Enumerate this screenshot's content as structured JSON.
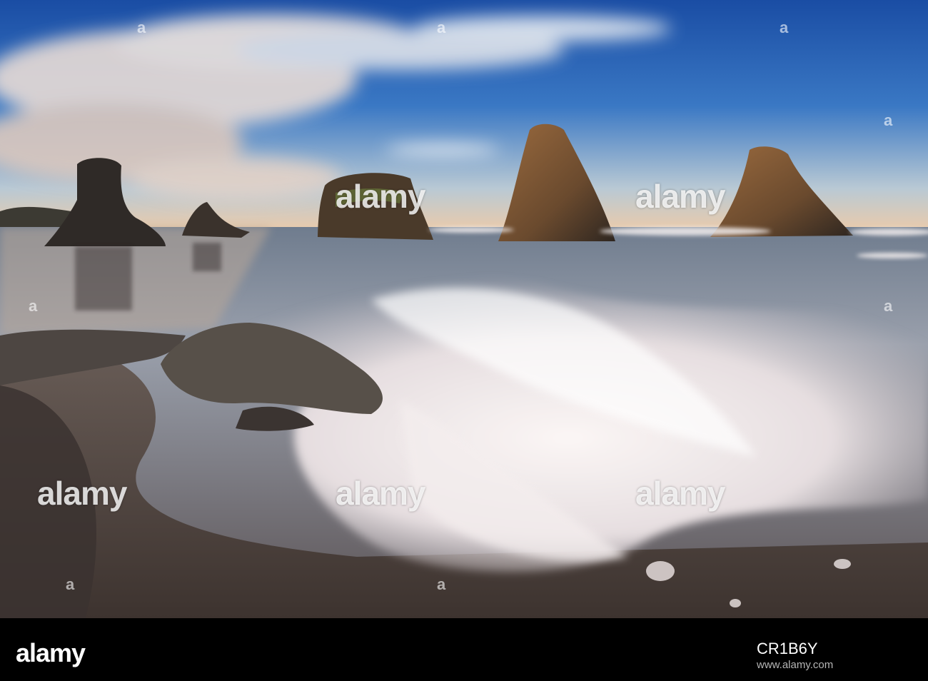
{
  "image": {
    "description_colors": {
      "sky_top": "#1c4fa3",
      "sky_horizon": "#e9c9a6",
      "rock": "#3a2f26",
      "rock_lit": "#8a5a34",
      "foam": "#f2ecec",
      "sand": "#4a403b"
    }
  },
  "watermark": {
    "text": "alamy",
    "small_mark": "a"
  },
  "footer": {
    "logo": "alamy",
    "image_id": "CR1B6Y",
    "url": "www.alamy.com"
  }
}
